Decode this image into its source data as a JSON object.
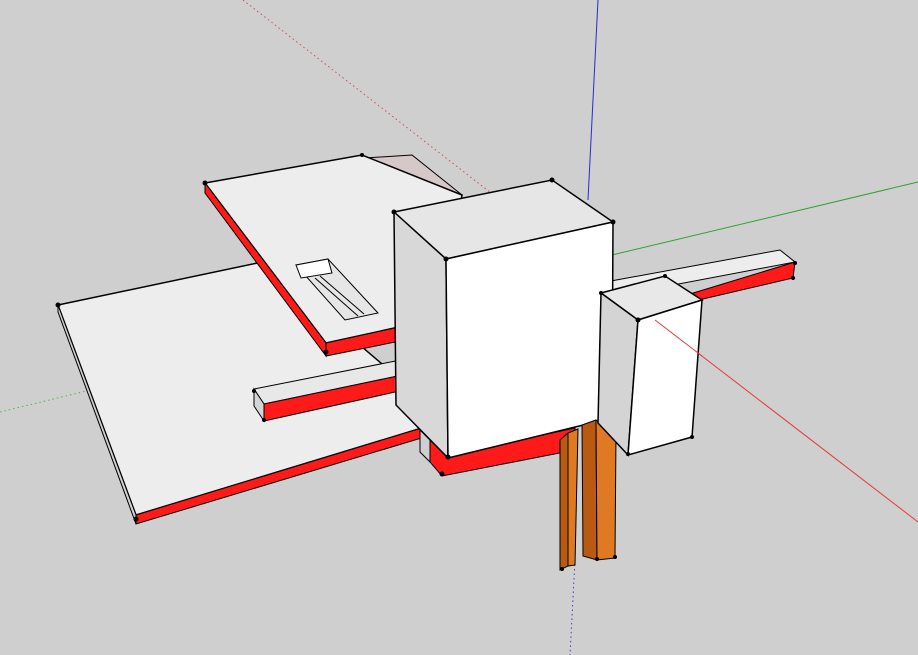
{
  "viewport": {
    "background": "#cfcfcf",
    "axes": {
      "red": "#e23b3b",
      "green": "#2ea32e",
      "blue": "#2a2ad0"
    },
    "model_colors": {
      "top_face": "#ededed",
      "side_face": "#d8d8d8",
      "light_face": "#ffffff",
      "back_face": "#d6c7c9",
      "red_band": "#ff1a1a",
      "wood_front": "#e07a22",
      "wood_side": "#b85a12",
      "edge": "#000000"
    }
  }
}
